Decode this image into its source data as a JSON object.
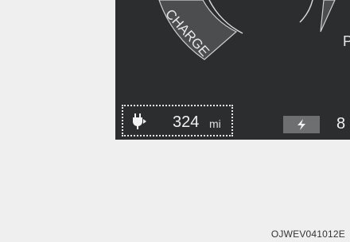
{
  "cluster": {
    "gauge_label": "CHARGE",
    "right_gauge_partial": "P",
    "range": {
      "value": "324",
      "unit": "mi",
      "icon": "ev-plug-icon"
    },
    "charge_indicator": {
      "icon": "lightning-bolt-icon"
    },
    "right_value_partial": "8"
  },
  "caption": {
    "code": "OJWEV041012E"
  },
  "colors": {
    "page_background": "#efefef",
    "cluster_background": "#2b2d2e",
    "dial_segment": "#4a4c4e",
    "dotted_highlight": "#e9e9e9"
  }
}
